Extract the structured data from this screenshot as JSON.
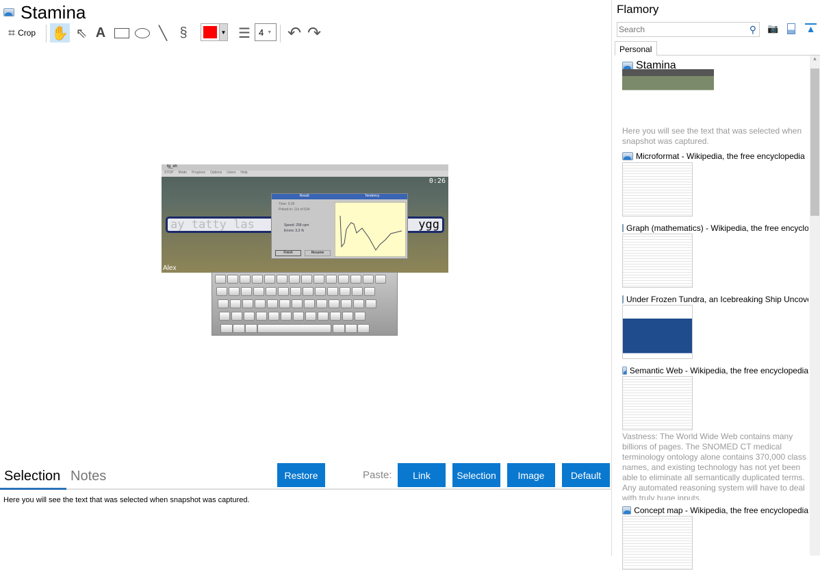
{
  "window": {
    "title": "Stamina"
  },
  "toolbar": {
    "crop_label": "Crop",
    "line_width": "4",
    "color": "#ff0000"
  },
  "snapshot": {
    "window_title": "tg_sh",
    "menu": [
      "STOP",
      "Mode",
      "Progress",
      "Options",
      "Users",
      "Help"
    ],
    "timer": "0:26",
    "typed_text": "ay tatty las",
    "next_text": "ygg",
    "user": "Alex",
    "dialog": {
      "result_tab": "Result",
      "tendency_tab": "Tendency",
      "time": "Time:  0:26",
      "poked": "Poked-in:  11s of 534",
      "speed": "Speed:  258 cpm",
      "errors": "Errors:  3.3 %",
      "finish": "Finish",
      "resume": "Resume"
    }
  },
  "bottom": {
    "tabs": [
      "Selection",
      "Notes"
    ],
    "restore": "Restore",
    "paste_label": "Paste:",
    "paste_buttons": [
      "Link",
      "Selection",
      "Image",
      "Default"
    ],
    "selection_text": "Here you will see the text that was selected when snapshot was captured."
  },
  "sidebar": {
    "title": "Flamory",
    "search_placeholder": "Search",
    "tab": "Personal",
    "items": [
      {
        "title": "Stamina",
        "desc": "Here you will see the text that was selected when snapshot was captured."
      },
      {
        "title": "Microformat - Wikipedia, the free encyclopedia"
      },
      {
        "title": "Graph (mathematics) - Wikipedia, the free encyclopedia"
      },
      {
        "title": "Under Frozen Tundra, an Icebreaking Ship Uncovers"
      },
      {
        "title": "Semantic Web - Wikipedia, the free encyclopedia",
        "desc": "Vastness: The World Wide Web contains many billions of pages. The SNOMED CT medical terminology ontology alone contains 370,000 class names, and existing technology has not yet been able to eliminate all semantically duplicated terms. Any automated reasoning system will have to deal with truly huge inputs."
      },
      {
        "title": "Concept map - Wikipedia, the free encyclopedia"
      }
    ]
  }
}
